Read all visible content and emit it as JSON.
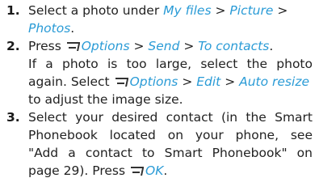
{
  "steps": [
    {
      "number": "1.",
      "lines": [
        {
          "a": "Select a photo under",
          "b": "My files",
          "c": ">",
          "d": "Picture",
          "e": ">"
        },
        {
          "a": "Photos",
          "b": "."
        }
      ]
    },
    {
      "number": "2.",
      "lines": [
        {
          "a": "Press",
          "b": "Options",
          "c": " > ",
          "d": "Send",
          "e": " > ",
          "f": "To contacts",
          "g": "."
        },
        {
          "a": "If a photo is too large, select the photo"
        },
        {
          "a": "again. Select",
          "b": "Options",
          "c": " > ",
          "d": "Edit",
          "e": " > ",
          "f": "Auto resize"
        },
        {
          "a": "to adjust the image size."
        }
      ]
    },
    {
      "number": "3.",
      "lines": [
        {
          "a": "Select your desired contact (in the Smart"
        },
        {
          "a": "Phonebook located on your phone, see"
        },
        {
          "a": "\"Add a contact to Smart Phonebook\" on"
        },
        {
          "a": "page 29). Press",
          "b": "OK",
          "c": "."
        }
      ]
    }
  ],
  "colors": {
    "link": "#2a9bd6",
    "text": "#222222"
  },
  "icons": {
    "softkey": "left-softkey-icon"
  }
}
